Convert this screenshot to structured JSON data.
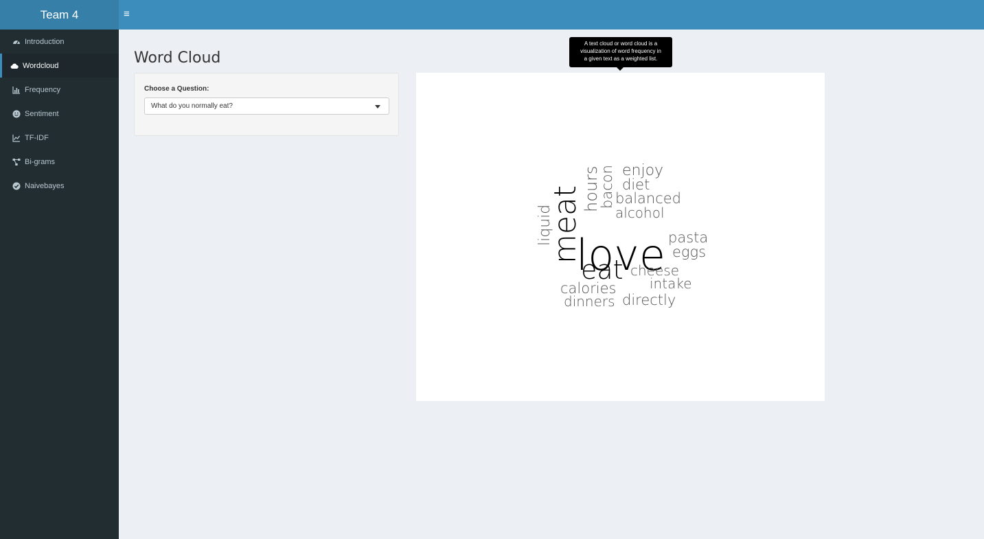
{
  "header": {
    "brand": "Team 4",
    "toggle_glyph": "≡"
  },
  "sidebar": {
    "items": [
      {
        "label": "Introduction",
        "icon": "dashboard-icon",
        "active": false
      },
      {
        "label": "Wordcloud",
        "icon": "cloud-icon",
        "active": true
      },
      {
        "label": "Frequency",
        "icon": "bar-chart-icon",
        "active": false
      },
      {
        "label": "Sentiment",
        "icon": "smile-icon",
        "active": false
      },
      {
        "label": "TF-IDF",
        "icon": "line-chart-icon",
        "active": false
      },
      {
        "label": "Bi-grams",
        "icon": "network-icon",
        "active": false
      },
      {
        "label": "Naivebayes",
        "icon": "check-circle-icon",
        "active": false
      }
    ]
  },
  "main": {
    "title": "Word Cloud",
    "question": {
      "label": "Choose a Question:",
      "selected": "What do you normally eat?"
    },
    "tooltip": {
      "line1": "A text cloud or word cloud is a",
      "line2": "visualization of word frequency in",
      "line3": "a given text as a weighted list."
    },
    "wordcloud": {
      "love": "love",
      "meat": "meat",
      "eat": "eat",
      "liquid": "liquid",
      "hours": "hours",
      "bacon": "bacon",
      "enjoy": "enjoy",
      "diet": "diet",
      "balanced": "balanced",
      "alcohol": "alcohol",
      "pasta": "pasta",
      "eggs": "eggs",
      "cheese": "cheese",
      "intake": "intake",
      "calories": "calories",
      "dinners": "dinners",
      "directly": "directly"
    }
  },
  "colors": {
    "header": "#3c8dbc",
    "logo": "#367fa9",
    "sidebar": "#222d32",
    "sidebar_active": "#1e282c",
    "background": "#ecf0f5"
  }
}
